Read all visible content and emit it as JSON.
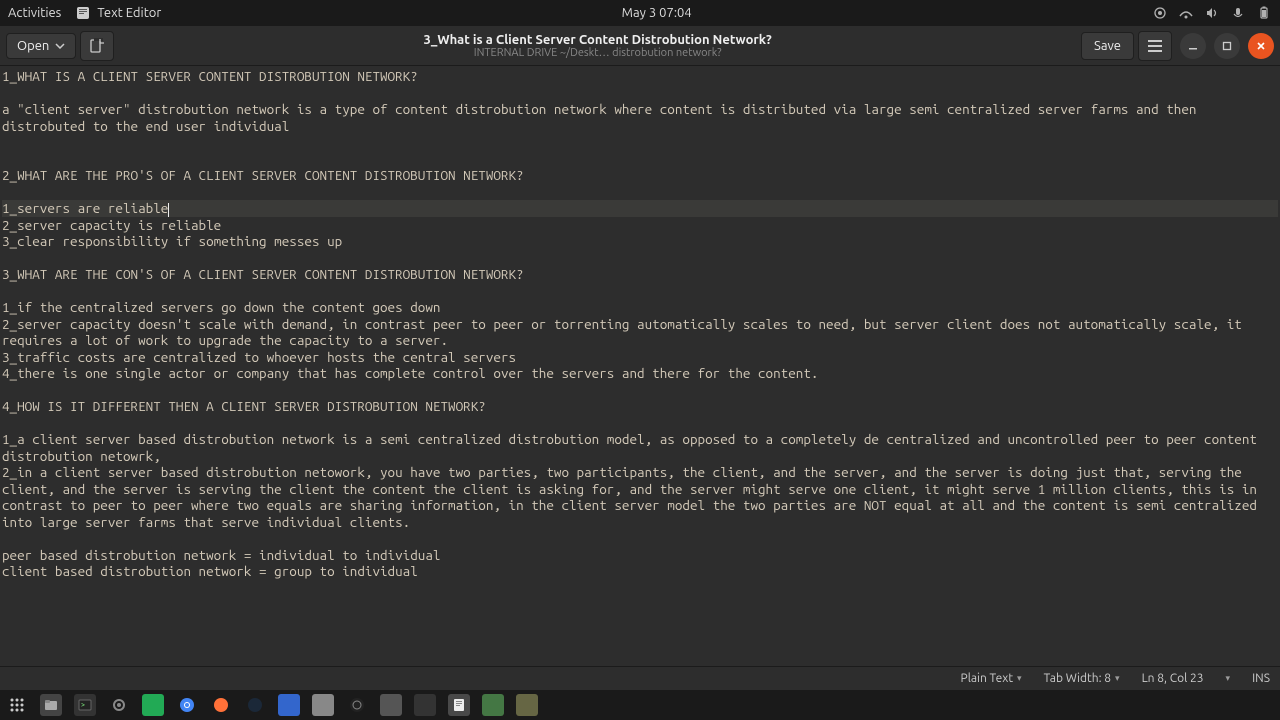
{
  "topbar": {
    "activities": "Activities",
    "app_name": "Text Editor",
    "clock": "May 3  07:04"
  },
  "header": {
    "open_label": "Open",
    "title": "3_What is a Client Server Content Distrobution Network?",
    "subtitle": "INTERNAL DRIVE ~/Deskt… distrobution network?",
    "save_label": "Save"
  },
  "document": {
    "lines": [
      "1_WHAT IS A CLIENT SERVER CONTENT DISTROBUTION NETWORK?",
      "",
      "a \"client server\" distrobution network is a type of content distrobution network where content is distributed via large semi centralized server farms and then distrobuted to the end user individual",
      "",
      "",
      "2_WHAT ARE THE PRO'S OF A CLIENT SERVER CONTENT DISTROBUTION NETWORK?",
      "",
      "1_servers are reliable",
      "2_server capacity is reliable",
      "3_clear responsibility if something messes up",
      "",
      "3_WHAT ARE THE CON'S OF A CLIENT SERVER CONTENT DISTROBUTION NETWORK?",
      "",
      "1_if the centralized servers go down the content goes down",
      "2_server capacity doesn't scale with demand, in contrast peer to peer or torrenting automatically scales to need, but server client does not automatically scale, it requires a lot of work to upgrade the capacity to a server.",
      "3_traffic costs are centralized to whoever hosts the central servers",
      "4_there is one single actor or company that has complete control over the servers and there for the content.",
      "",
      "4_HOW IS IT DIFFERENT THEN A CLIENT SERVER DISTROBUTION NETWORK?",
      "",
      "1_a client server based distrobution network is a semi centralized distrobution model, as opposed to a completely de centralized and uncontrolled peer to peer content distrobution netowrk,",
      "2_in a client server based distrobution netowork, you have two parties, two participants, the client, and the server, and the server is doing just that, serving the client, and the server is serving the client the content the client is asking for, and the server might serve one client, it might serve 1 million clients, this is in contrast to peer to peer where two equals are sharing information, in the client server model the two parties are NOT equal at all and the content is semi centralized into large server farms that serve individual clients.",
      "",
      "peer based distrobution network = individual to individual",
      "client based distrobution network = group to individual"
    ],
    "current_line_index": 7,
    "cursor_col": 22
  },
  "statusbar": {
    "syntax": "Plain Text",
    "tab_width_label": "Tab Width: 8",
    "position": "Ln 8, Col 23",
    "insert_mode": "INS"
  }
}
